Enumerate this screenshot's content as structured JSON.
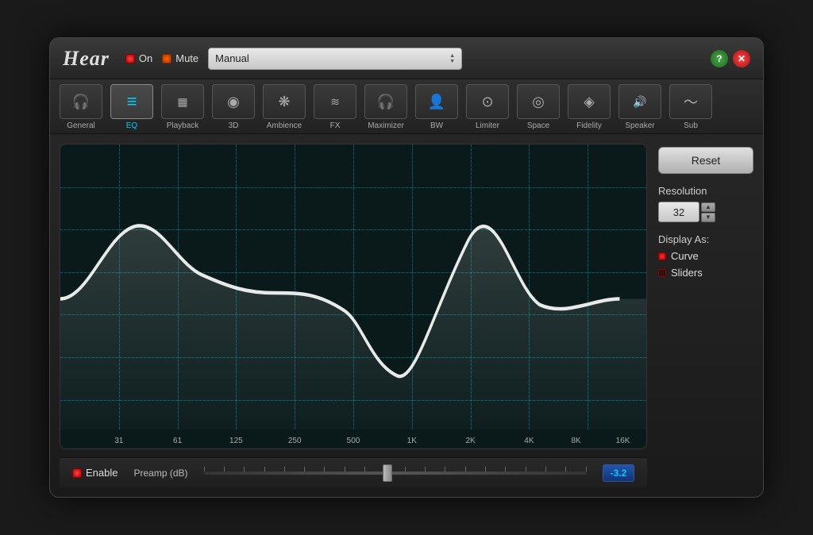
{
  "app": {
    "title": "Hear"
  },
  "header": {
    "on_label": "On",
    "mute_label": "Mute",
    "preset_value": "Manual",
    "help_label": "?",
    "close_label": "✕"
  },
  "tabs": [
    {
      "id": "general",
      "label": "General",
      "icon": "🎧",
      "active": false
    },
    {
      "id": "eq",
      "label": "EQ",
      "icon": "≡",
      "active": true
    },
    {
      "id": "playback",
      "label": "Playback",
      "icon": "▦",
      "active": false
    },
    {
      "id": "3d",
      "label": "3D",
      "icon": "◉",
      "active": false
    },
    {
      "id": "ambience",
      "label": "Ambience",
      "icon": "❋",
      "active": false
    },
    {
      "id": "fx",
      "label": "FX",
      "icon": "≋",
      "active": false
    },
    {
      "id": "maximizer",
      "label": "Maximizer",
      "icon": "🎧",
      "active": false
    },
    {
      "id": "bw",
      "label": "BW",
      "icon": "👤",
      "active": false
    },
    {
      "id": "limiter",
      "label": "Limiter",
      "icon": "⊙",
      "active": false
    },
    {
      "id": "space",
      "label": "Space",
      "icon": "◎",
      "active": false
    },
    {
      "id": "fidelity",
      "label": "Fidelity",
      "icon": "◈",
      "active": false
    },
    {
      "id": "speaker",
      "label": "Speaker",
      "icon": "🔊",
      "active": false
    },
    {
      "id": "sub",
      "label": "Sub",
      "icon": "〜",
      "active": false
    }
  ],
  "eq": {
    "freq_labels": [
      "31",
      "61",
      "125",
      "250",
      "500",
      "1K",
      "2K",
      "4K",
      "8K",
      "16K"
    ],
    "resolution_value": "32",
    "display_as": {
      "label": "Display As:",
      "curve_label": "Curve",
      "sliders_label": "Sliders"
    },
    "reset_label": "Reset",
    "resolution_label": "Resolution"
  },
  "bottom_bar": {
    "enable_label": "Enable",
    "preamp_label": "Preamp (dB)",
    "preamp_value": "-3.2"
  }
}
